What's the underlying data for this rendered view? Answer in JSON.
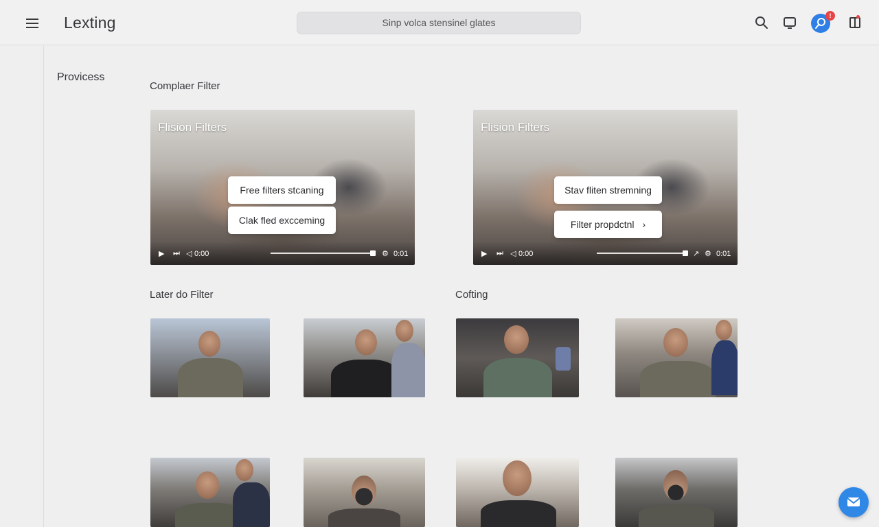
{
  "header": {
    "app_title": "Lexting",
    "search_text": "Sinp volca stensinel glates",
    "notification_count": "!",
    "icons": [
      "menu-icon",
      "search-icon",
      "cast-icon",
      "profile-icon",
      "panel-icon"
    ]
  },
  "sidebar": {
    "label": "Provicess"
  },
  "sections": {
    "top_title": "Complaer Filter",
    "lower_left_title": "Later do Filter",
    "lower_right_title": "Cofting"
  },
  "videos": [
    {
      "title": "Flision Filters",
      "pill_1": "Free filters stcaning",
      "pill_2": "Clak fled excceming",
      "time_left": "0:00",
      "time_right": "0:01"
    },
    {
      "title": "Flision Filters",
      "pill_1": "Stav fliten stremning",
      "pill_2": "Filter propdctnl",
      "pill_2_chevron": "›",
      "time_left": "0:00",
      "time_right": "0:01"
    }
  ],
  "colors": {
    "accent": "#2f87e6",
    "badge": "#e74545",
    "background": "#efeff0"
  }
}
